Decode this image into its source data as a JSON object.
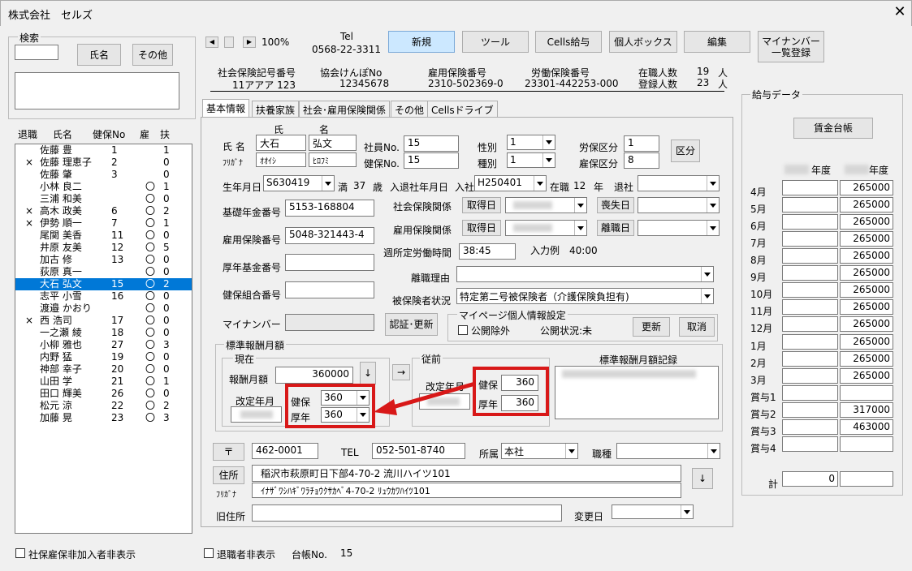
{
  "window": {
    "title": "株式会社　セルズ",
    "close": "✕"
  },
  "search": {
    "group": "検索",
    "input": "",
    "name_btn": "氏名",
    "other_btn": "その他"
  },
  "list": {
    "headers": [
      "退職",
      "氏名",
      "健保No",
      "雇",
      "扶"
    ],
    "rows": [
      {
        "ret": "",
        "name": "佐藤 豊",
        "no": "1",
        "koyo": "",
        "fu": "1"
      },
      {
        "ret": "×",
        "name": "佐藤 理恵子",
        "no": "2",
        "koyo": "",
        "fu": "0"
      },
      {
        "ret": "",
        "name": "佐藤 肇",
        "no": "3",
        "koyo": "",
        "fu": "0"
      },
      {
        "ret": "",
        "name": "小林 良二",
        "no": "",
        "koyo": "〇",
        "fu": "1"
      },
      {
        "ret": "",
        "name": "三浦 和美",
        "no": "",
        "koyo": "〇",
        "fu": "0"
      },
      {
        "ret": "×",
        "name": "高木 政美",
        "no": "6",
        "koyo": "〇",
        "fu": "2"
      },
      {
        "ret": "×",
        "name": "伊勢 順一",
        "no": "7",
        "koyo": "〇",
        "fu": "1"
      },
      {
        "ret": "",
        "name": "尾関 美香",
        "no": "11",
        "koyo": "〇",
        "fu": "0"
      },
      {
        "ret": "",
        "name": "井原 友美",
        "no": "12",
        "koyo": "〇",
        "fu": "5"
      },
      {
        "ret": "",
        "name": "加古 修",
        "no": "13",
        "koyo": "〇",
        "fu": "0"
      },
      {
        "ret": "",
        "name": "荻原 真一",
        "no": "",
        "koyo": "〇",
        "fu": "0"
      },
      {
        "ret": "",
        "name": "大石 弘文",
        "no": "15",
        "koyo": "〇",
        "fu": "2"
      },
      {
        "ret": "",
        "name": "志平 小雪",
        "no": "16",
        "koyo": "〇",
        "fu": "0"
      },
      {
        "ret": "",
        "name": "渡邉 かおり",
        "no": "",
        "koyo": "〇",
        "fu": "0"
      },
      {
        "ret": "×",
        "name": "西 浩司",
        "no": "17",
        "koyo": "〇",
        "fu": "0"
      },
      {
        "ret": "",
        "name": "一之瀬 綾",
        "no": "18",
        "koyo": "〇",
        "fu": "0"
      },
      {
        "ret": "",
        "name": "小柳 雅也",
        "no": "27",
        "koyo": "〇",
        "fu": "3"
      },
      {
        "ret": "",
        "name": "内野 猛",
        "no": "19",
        "koyo": "〇",
        "fu": "0"
      },
      {
        "ret": "",
        "name": "神部 幸子",
        "no": "20",
        "koyo": "〇",
        "fu": "0"
      },
      {
        "ret": "",
        "name": "山田 学",
        "no": "21",
        "koyo": "〇",
        "fu": "1"
      },
      {
        "ret": "",
        "name": "田口 輝美",
        "no": "26",
        "koyo": "〇",
        "fu": "0"
      },
      {
        "ret": "",
        "name": "松元 涼",
        "no": "22",
        "koyo": "〇",
        "fu": "2"
      },
      {
        "ret": "",
        "name": "加藤 晃",
        "no": "23",
        "koyo": "〇",
        "fu": "3"
      }
    ],
    "selected_index": 11
  },
  "bottom": {
    "hide_non_member": "社保雇保非加入者非表示",
    "hide_retired": "退職者非表示",
    "ledger_label": "台帳No.",
    "ledger_no": "15"
  },
  "toolbar": {
    "zoom": "100%",
    "tel_label": "Tel",
    "tel": "0568-22-3311",
    "new": "新規",
    "tool": "ツール",
    "cells_pay": "Cells給与",
    "personal_box": "個人ボックス",
    "edit": "編集",
    "mynumber_line1": "マイナンバー",
    "mynumber_line2": "一覧登録"
  },
  "company": {
    "shaho_label": "社会保険記号番号",
    "shaho": "11アアア 123",
    "kyokai_label": "協会けんぽNo",
    "kyokai": "12345678",
    "koyo_label": "雇用保険番号",
    "koyo": "2310-502369-0",
    "rodo_label": "労働保険番号",
    "rodo": "23301-442253-000",
    "zaishoku_label": "在職人数",
    "zaishoku": "19",
    "toroku_label": "登録人数",
    "toroku": "23",
    "unit": "人"
  },
  "tabs": [
    "基本情報",
    "扶養家族",
    "社会･雇用保険関係",
    "その他",
    "Cellsドライブ"
  ],
  "basic": {
    "sei_header": "氏",
    "mei_header": "名",
    "name_label": "氏 名",
    "kana_label": "ﾌﾘｶﾞﾅ",
    "sei": "大石",
    "mei": "弘文",
    "sei_kana": "ｵｵｲｼ",
    "mei_kana": "ﾋﾛﾌﾐ",
    "shain_label": "社員No.",
    "shain_no": "15",
    "kenpo_label": "健保No.",
    "kenpo_no": "15",
    "seibetsu_label": "性別",
    "seibetsu": "1",
    "shubetsu_label": "種別",
    "shubetsu": "1",
    "rouho_label": "労保区分",
    "rouho": "1",
    "koho_label": "雇保区分",
    "koho": "8",
    "kubun_btn": "区分",
    "birth_label": "生年月日",
    "birth": "S630419",
    "man": "満",
    "age": "37",
    "sai": "歳",
    "nyutai_label": "入退社年月日",
    "nyusha": "入社",
    "nyusha_date": "H250401",
    "zaishoku": "在職",
    "years": "12",
    "nen": "年",
    "taisha": "退社",
    "kiso_label": "基礎年金番号",
    "kiso": "5153-168804",
    "koyo_no_label": "雇用保険番号",
    "koyo_no": "5048-321443-4",
    "kosei_label": "厚年基金番号",
    "kosei": "",
    "kumiai_label": "健保組合番号",
    "kumiai": "",
    "mynumber_label": "マイナンバー",
    "ninsho_btn": "認証･更新",
    "shaho_kankei": "社会保険関係",
    "shutoku_btn": "取得日",
    "soshitsu_btn": "喪失日",
    "koyo_kankei": "雇用保険関係",
    "rishoku_btn": "離職日",
    "shoteki_label": "週所定労働時間",
    "shoteki": "38:45",
    "nyuryoku_rei": "入力例　40:00",
    "rishoku_riyu": "離職理由",
    "hihoken_label": "被保険者状況",
    "hihoken": "特定第二号被保険者（介護保険負担有)",
    "mypage_group": "マイページ個人情報設定",
    "kokai_jogai": "公開除外",
    "kokai_status": "公開状況:未",
    "koshin": "更新",
    "torikeshi": "取消"
  },
  "hyojun": {
    "group": "標準報酬月額",
    "genzai": "現在",
    "hoshu_label": "報酬月額",
    "hoshu": "360000",
    "down_arrow": "↓",
    "kaitei_label": "改定年月",
    "kenpo_label": "健保",
    "kenpo": "360",
    "konen_label": "厚年",
    "konen": "360",
    "right_arrow": "→",
    "juzen": "従前",
    "juzen_kaitei": "改定年月",
    "juzen_kenpo": "360",
    "juzen_konen": "360",
    "kiroku": "標準報酬月額記録"
  },
  "address": {
    "postal_btn": "〒",
    "postal": "462-0001",
    "tel_label": "TEL",
    "tel": "052-501-8740",
    "shozoku_label": "所属",
    "shozoku": "本社",
    "shokushu_label": "職種",
    "jusho_btn": "住所",
    "furigana_label": "ﾌﾘｶﾞﾅ",
    "address": "稲沢市萩原町日下部4-70-2 流川ハイツ101",
    "address_kana": "ｲﾅｻﾞﾜｼﾊｷﾞﾜﾗﾁｮｳｸｻｶﾍﾞ4-70-2 ﾘｭｳｶﾜﾊｲﾂ101",
    "down_btn": "↓",
    "old_label": "旧住所",
    "henko_label": "変更日"
  },
  "payroll": {
    "group": "給与データ",
    "ledger_btn": "賃金台帳",
    "year_header": "年度",
    "months": [
      "4月",
      "5月",
      "6月",
      "7月",
      "8月",
      "9月",
      "10月",
      "11月",
      "12月",
      "1月",
      "2月",
      "3月",
      "賞与1",
      "賞与2",
      "賞与3",
      "賞与4"
    ],
    "values": [
      "265000",
      "265000",
      "265000",
      "265000",
      "265000",
      "265000",
      "265000",
      "265000",
      "265000",
      "265000",
      "265000",
      "265000",
      "",
      "317000",
      "463000",
      ""
    ],
    "total_label": "計",
    "total": "0"
  },
  "colors": {
    "accent": "#cce8ff",
    "selection": "#0078d7",
    "highlight": "#d81818"
  }
}
